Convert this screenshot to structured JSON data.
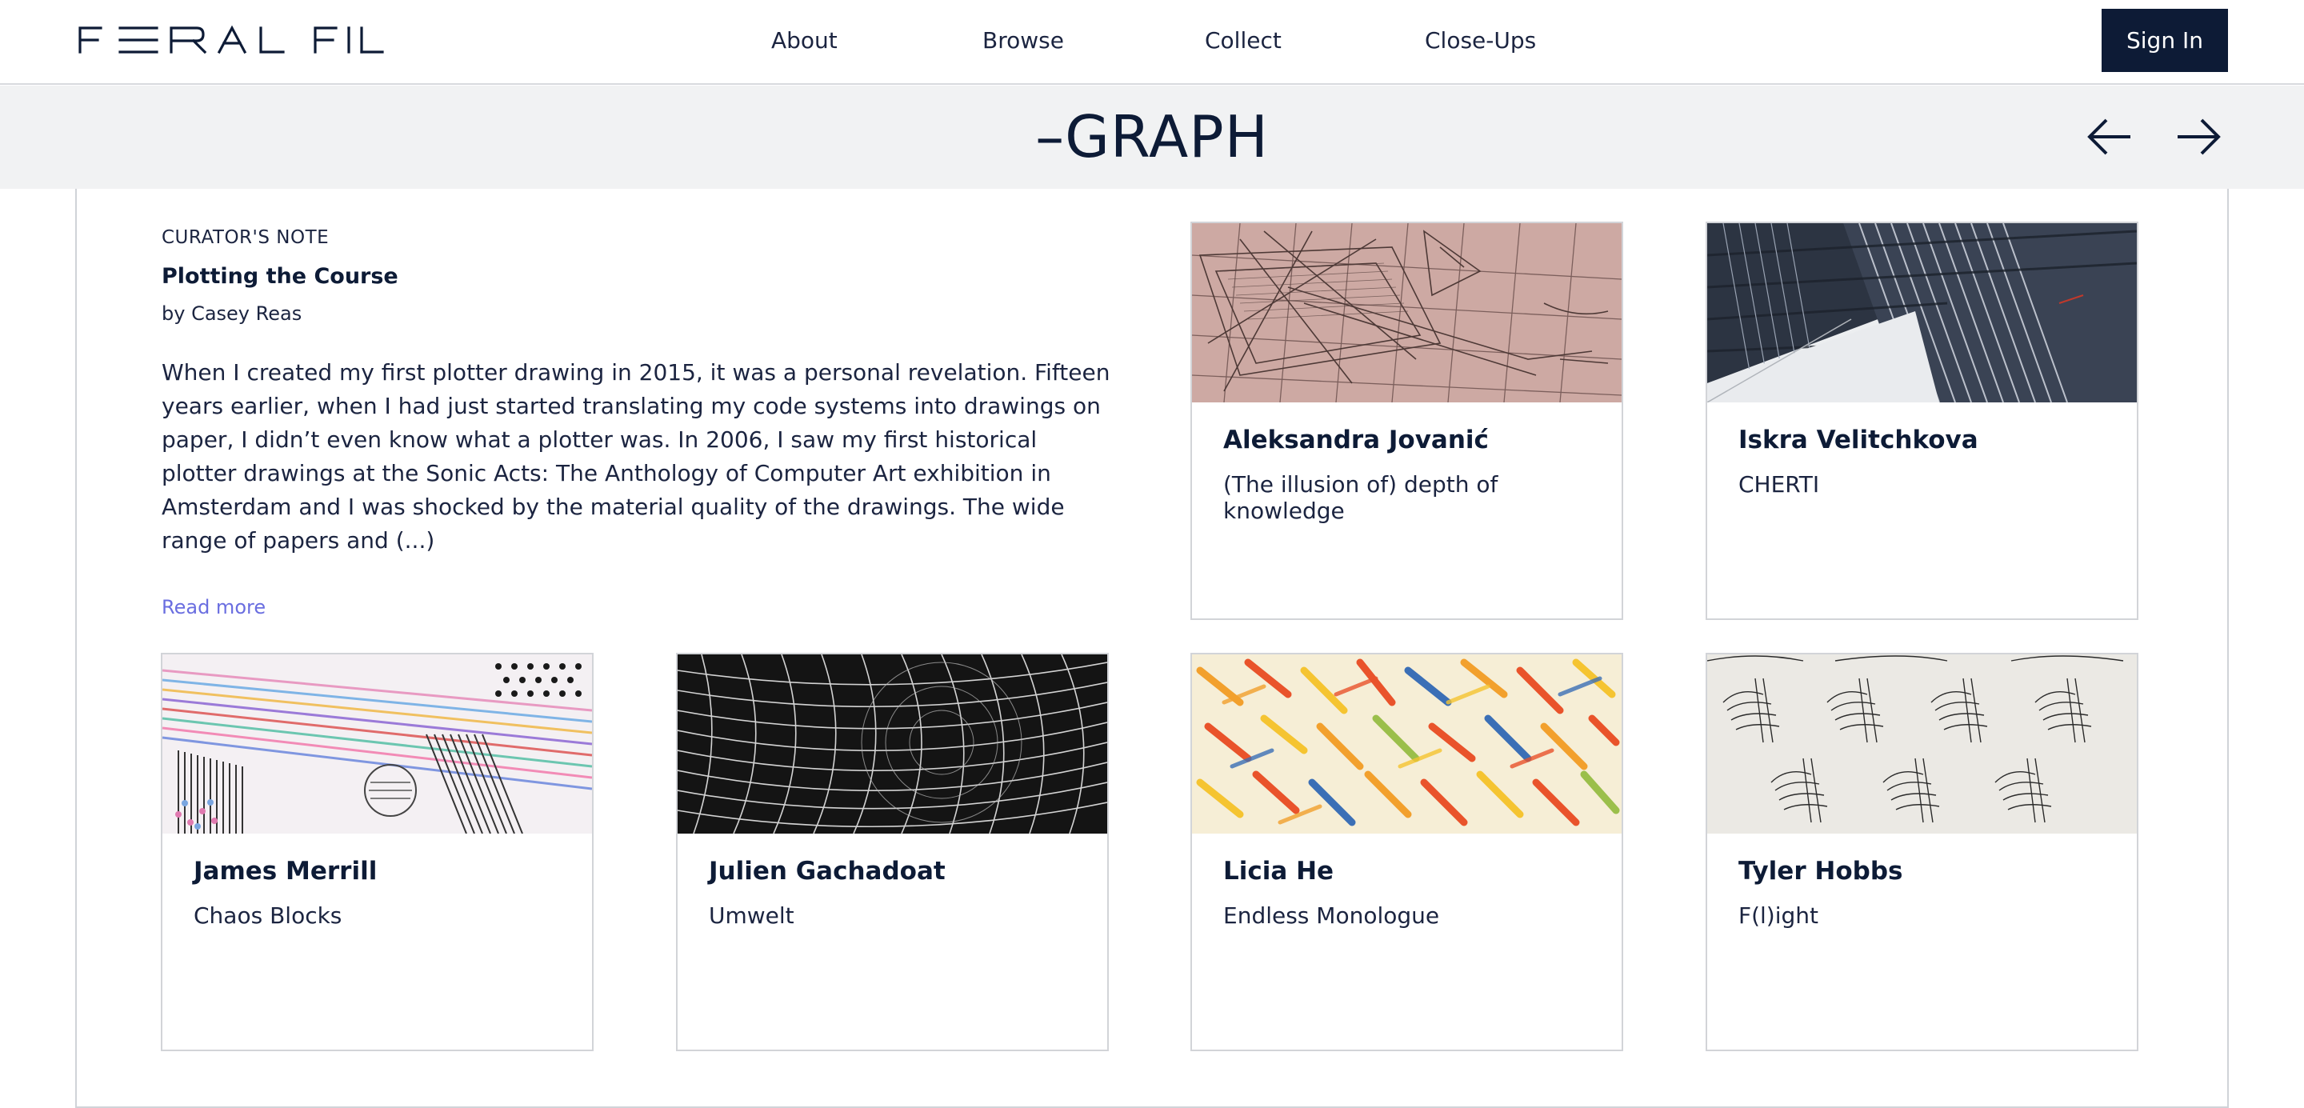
{
  "header": {
    "logo_text": "FERAL FILE",
    "nav": [
      "About",
      "Browse",
      "Collect",
      "Close-Ups"
    ],
    "sign_in": "Sign In"
  },
  "band": {
    "title": "–GRAPH",
    "prev_icon": "arrow-left-icon",
    "next_icon": "arrow-right-icon"
  },
  "curator_note": {
    "label": "CURATOR'S NOTE",
    "title": "Plotting the Course",
    "author": "by Casey Reas",
    "body": "When I created my first plotter drawing in 2015, it was a personal revelation. Fifteen years earlier, when I had just started translating my code systems into drawings on paper, I didn’t even know what a plotter was. In 2006, I saw my first historical plotter drawings at the Sonic Acts: The Anthology of Computer Art exhibition in Amsterdam and I was shocked by the material quality of the drawings. The wide range of papers and (...)",
    "read_more": "Read more"
  },
  "artworks": [
    {
      "artist": "Aleksandra Jovanić",
      "title": "(The illusion of) depth of knowledge"
    },
    {
      "artist": "Iskra Velitchkova",
      "title": "CHERTI"
    },
    {
      "artist": "James Merrill",
      "title": "Chaos Blocks"
    },
    {
      "artist": "Julien Gachadoat",
      "title": "Umwelt"
    },
    {
      "artist": "Licia He",
      "title": "Endless Monologue"
    },
    {
      "artist": "Tyler Hobbs",
      "title": "F(l)ight"
    }
  ],
  "colors": {
    "navy": "#0d1b36",
    "band_bg": "#f1f2f3",
    "link": "#6a6ee0",
    "border": "#d2d4d8"
  }
}
